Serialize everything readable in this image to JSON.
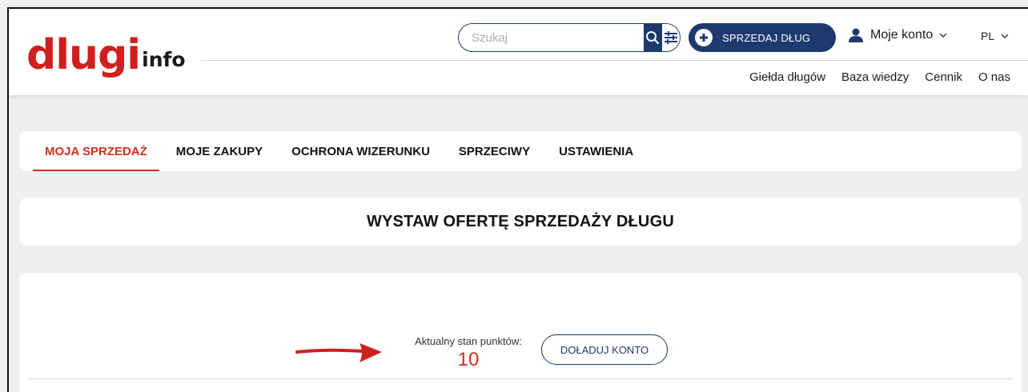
{
  "brand": {
    "logo_main": "dlugi",
    "logo_sub": "info",
    "brand_color": "#d01f1f"
  },
  "search": {
    "placeholder": "Szukaj",
    "value": ""
  },
  "header": {
    "sell_label": "SPRZEDAJ DŁUG",
    "account_label": "Moje konto",
    "language": "PL",
    "nav": [
      "Giełda długów",
      "Baza wiedzy",
      "Cennik",
      "O nas"
    ]
  },
  "tabs": [
    {
      "label": "MOJA SPRZEDAŻ",
      "active": true
    },
    {
      "label": "MOJE ZAKUPY",
      "active": false
    },
    {
      "label": "OCHRONA WIZERUNKU",
      "active": false
    },
    {
      "label": "SPRZECIWY",
      "active": false
    },
    {
      "label": "USTAWIENIA",
      "active": false
    }
  ],
  "page_title": "WYSTAW OFERTĘ SPRZEDAŻY DŁUGU",
  "points": {
    "label": "Aktualny stan punktów:",
    "value": "10",
    "topup_label": "DOŁADUJ KONTO"
  },
  "colors": {
    "primary": "#1d3a6e",
    "accent": "#d0311f",
    "background": "#efeff1"
  },
  "icons": [
    "search-icon",
    "filter-icon",
    "plus-circle-icon",
    "user-icon",
    "chevron-down-icon",
    "arrow-annotation-icon"
  ]
}
